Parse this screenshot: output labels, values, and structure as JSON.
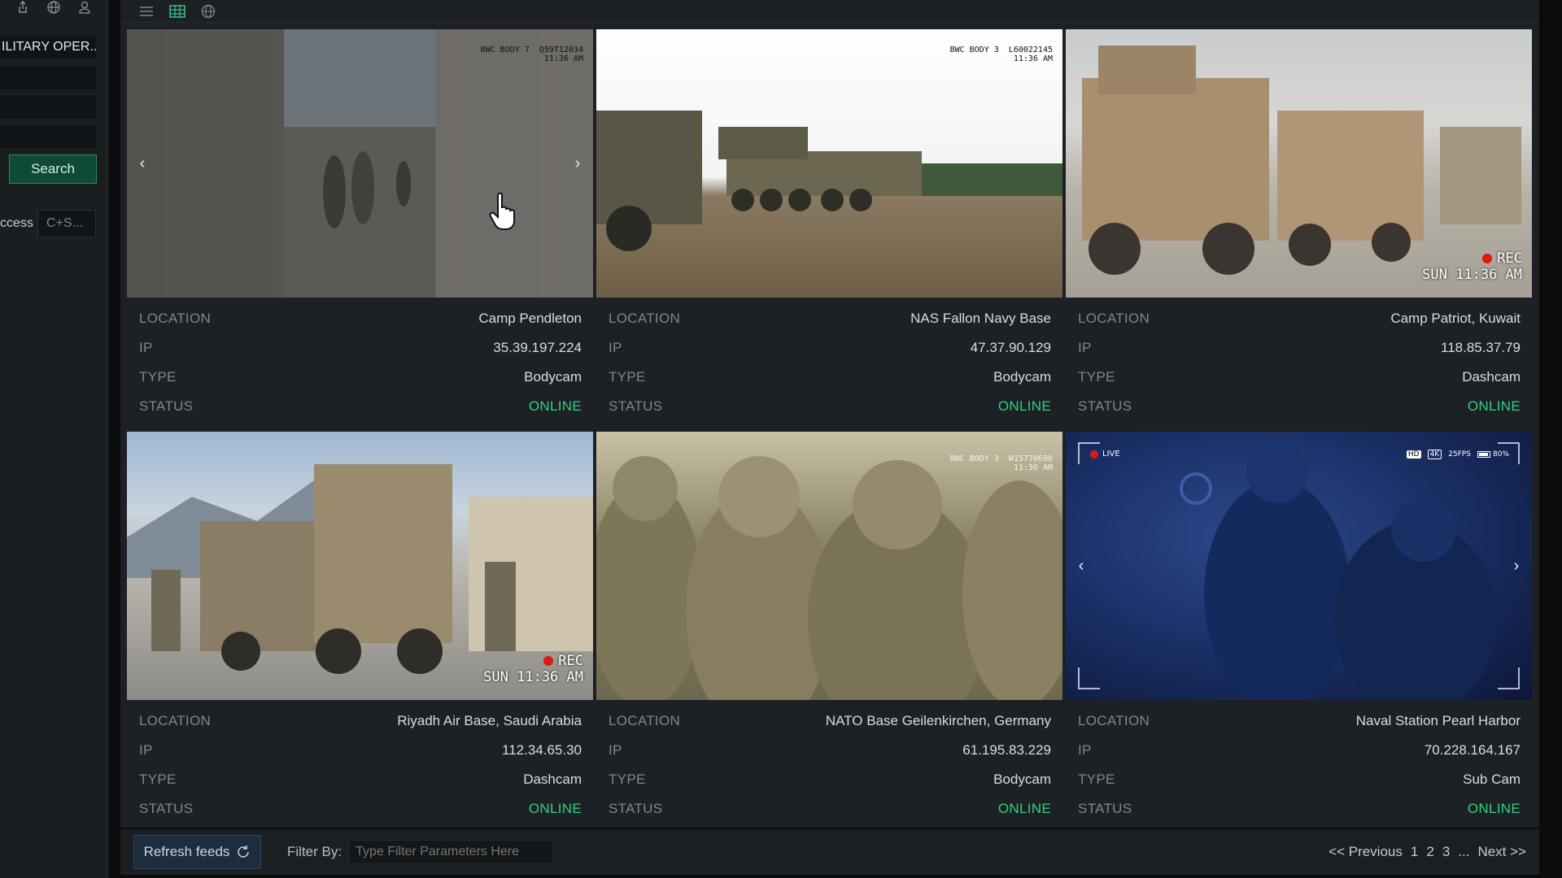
{
  "sidebar": {
    "operation_label": "ILITARY OPER...",
    "search_button": "Search",
    "access_label": "ccess",
    "access_value": "C+S..."
  },
  "toolbar": {
    "icons": [
      "menu-icon",
      "grid-icon",
      "globe-icon"
    ],
    "active": "grid-icon"
  },
  "cards": [
    {
      "overlay_text": "BWC BODY 7  Q59T12034\n11:36 AM",
      "location": "Camp Pendleton",
      "ip": "35.39.197.224",
      "type": "Bodycam",
      "status": "ONLINE"
    },
    {
      "overlay_text": "BWC BODY 3  L60022145\n11:36 AM",
      "location": "NAS Fallon Navy Base",
      "ip": "47.37.90.129",
      "type": "Bodycam",
      "status": "ONLINE"
    },
    {
      "rec_label": "REC",
      "rec_time": "SUN 11:36 AM",
      "location": "Camp Patriot, Kuwait",
      "ip": "118.85.37.79",
      "type": "Dashcam",
      "status": "ONLINE"
    },
    {
      "rec_label": "REC",
      "rec_time": "SUN 11:36 AM",
      "location": "Riyadh Air Base, Saudi Arabia",
      "ip": "112.34.65.30",
      "type": "Dashcam",
      "status": "ONLINE"
    },
    {
      "overlay_text": "BWC BODY 3  W15770690\n11:36 AM",
      "location": "NATO Base Geilenkirchen, Germany",
      "ip": "61.195.83.229",
      "type": "Bodycam",
      "status": "ONLINE"
    },
    {
      "live_label": "LIVE",
      "hud": [
        "HD",
        "4K",
        "25FPS",
        "80%"
      ],
      "location": "Naval Station Pearl Harbor",
      "ip": "70.228.164.167",
      "type": "Sub Cam",
      "status": "ONLINE"
    }
  ],
  "labels": {
    "location": "LOCATION",
    "ip": "IP",
    "type": "TYPE",
    "status": "STATUS"
  },
  "bottom": {
    "refresh": "Refresh feeds",
    "filter_label": "Filter By:",
    "filter_placeholder": "Type Filter Parameters Here",
    "prev": "<< Previous",
    "pages": [
      "1",
      "2",
      "3",
      "..."
    ],
    "next": "Next >>"
  },
  "colors": {
    "online": "#2fd37a",
    "accent": "#0f4a34",
    "rec": "#e01515"
  }
}
